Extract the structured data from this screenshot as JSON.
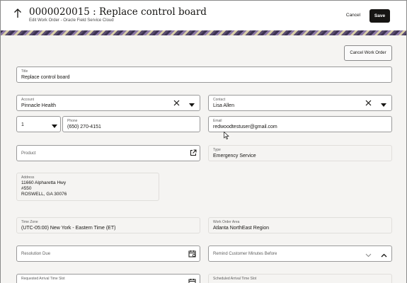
{
  "header": {
    "title": "0000020015 : Replace control board",
    "subtitle": "Edit Work Order - Oracle Field Service Cloud",
    "cancel_label": "Cancel",
    "save_label": "Save"
  },
  "actions": {
    "cancel_work_order_label": "Cancel Work Order"
  },
  "form": {
    "title": {
      "label": "Title",
      "value": "Replace control board"
    },
    "account": {
      "label": "Account",
      "value": "Pinnacle Health"
    },
    "contact": {
      "label": "Contact",
      "value": "Lisa Allen"
    },
    "phone_type": {
      "value": "1"
    },
    "phone": {
      "label": "Phone",
      "value": "(650) 270-4151"
    },
    "email": {
      "label": "Email",
      "value": "redwoodtestuser@gmail.com"
    },
    "product": {
      "label": "Product"
    },
    "type": {
      "label": "Type",
      "value": "Emergency Service"
    },
    "address": {
      "label": "Address",
      "line1": "11660 Alpharetta Hwy",
      "line2": "#550",
      "line3": "ROSWELL, GA 30076"
    },
    "time_zone": {
      "label": "Time Zone",
      "value": "(UTC-05:00) New York - Eastern Time (ET)"
    },
    "work_order_area": {
      "label": "Work Order Area",
      "value": "Atlanta NorthEast Region"
    },
    "resolution_due": {
      "label": "Resolution Due"
    },
    "remind_customer": {
      "label": "Remind Customer Minutes Before"
    },
    "requested_arrival": {
      "label": "Requested Arrival Time Slot"
    },
    "scheduled_arrival": {
      "label": "Scheduled Arrival Time Slot"
    }
  },
  "icons": {
    "back": "arrow-up-icon",
    "clear": "close-icon",
    "dropdown": "chevron-down-icon",
    "open": "open-external-icon",
    "calendar": "calendar-icon",
    "collapse": "chevron-up-icon"
  }
}
